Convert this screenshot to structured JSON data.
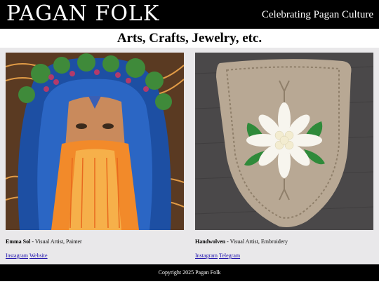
{
  "header": {
    "brand": "PAGAN FOLK",
    "tagline": "Celebrating Pagan Culture"
  },
  "section": {
    "title": "Arts, Crafts, Jewelry, etc."
  },
  "artists": [
    {
      "name": "Emma Sol",
      "description": " - Visual Artist, Painter",
      "links": [
        "Instagram",
        "Website"
      ],
      "image": "bearded-green-man-painting"
    },
    {
      "name": "Handwolven",
      "description": " - Visual Artist, Embroidery",
      "links": [
        "Instagram",
        "Telegram"
      ],
      "image": "edelweiss-embroidered-shield"
    }
  ],
  "footer": {
    "copyright": "Copyright 2025 Pagan Folk"
  },
  "colors": {
    "header_bg": "#000000",
    "gallery_bg": "#e9e8ea",
    "link": "#1a0dab"
  }
}
